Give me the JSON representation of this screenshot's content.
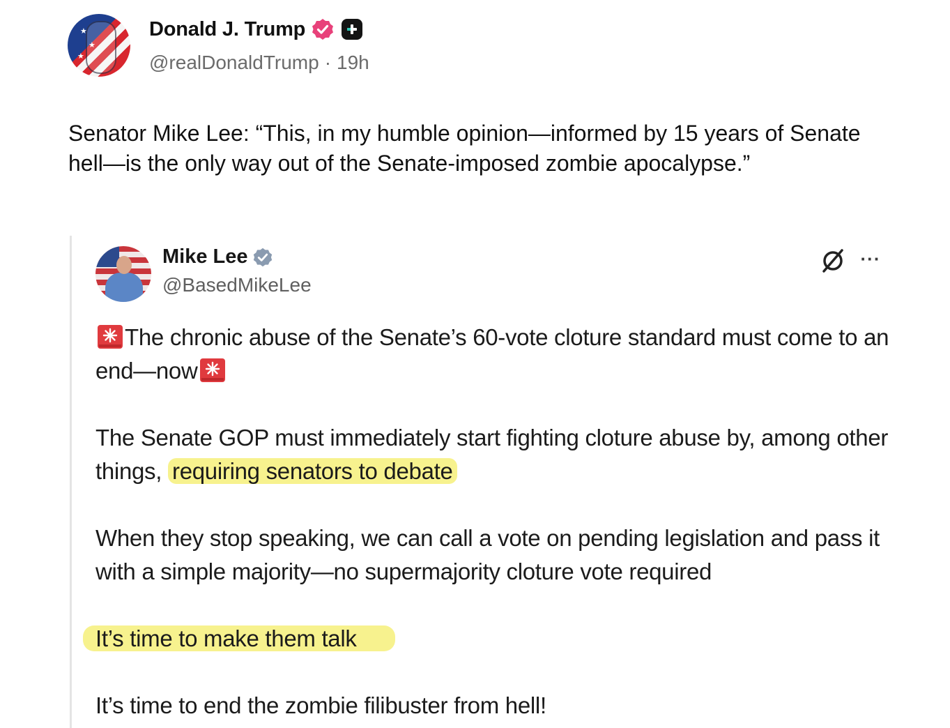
{
  "author": {
    "display_name": "Donald J. Trump",
    "handle": "@realDonaldTrump",
    "separator": "·",
    "time_ago": "19h",
    "avatar_icon": "flag-portrait-avatar",
    "verified_icon": "verified-badge-icon",
    "plus_icon": "plus-badge-icon",
    "verified_color": "#e8417a"
  },
  "post": {
    "text": "Senator Mike Lee: “This, in my humble opinion—informed by 15 years of Senate hell—is the only way out of the Senate-imposed zombie apocalypse.”"
  },
  "quote": {
    "display_name": "Mike Lee",
    "handle": "@BasedMikeLee",
    "verified_color": "#8a9bb0",
    "grok_icon": "grok-icon",
    "more_icon": "more-options-icon",
    "more_label": "···",
    "para1_text": "The chronic abuse of the Senate’s 60-vote cloture standard must come to an end—now",
    "para2_text": "The Senate GOP must immediately start fighting cloture abuse by, among other things, ",
    "para2_highlight": "requiring senators to debate",
    "para3_text": "When they stop speaking, we can call a vote on pending legislation and pass it with a simple majority—no supermajority cloture vote required",
    "para4_highlight": "It’s time to make them talk",
    "para5_text": "It’s time to end the zombie filibuster from hell!",
    "highlight_color": "#f7f28e",
    "siren_icon": "siren-emoji-icon"
  }
}
